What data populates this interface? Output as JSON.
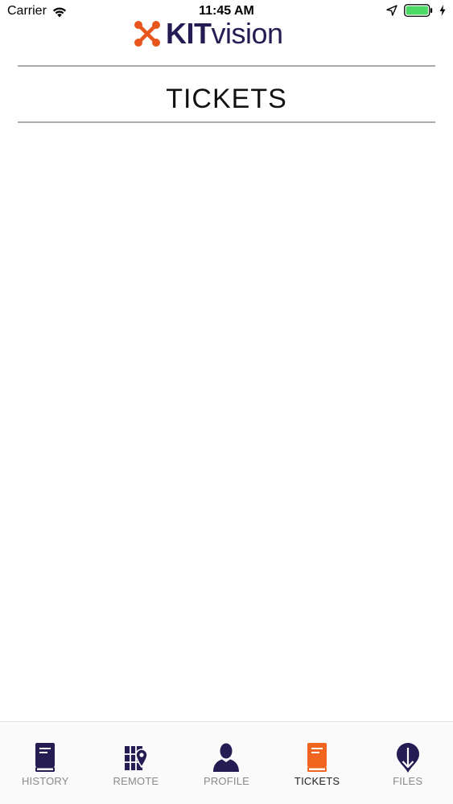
{
  "status_bar": {
    "carrier": "Carrier",
    "time": "11:45 AM"
  },
  "logo": {
    "kit": "KIT",
    "vision": "vision",
    "mark_color": "#e8561e",
    "text_color": "#241c52"
  },
  "header": {
    "title": "TICKETS"
  },
  "colors": {
    "tab_inactive_icon": "#241c52",
    "tab_active_icon": "#f0641e",
    "battery": "#4cd964"
  },
  "tabs": [
    {
      "label": "HISTORY",
      "icon": "book-icon",
      "active": false
    },
    {
      "label": "REMOTE",
      "icon": "map-pin-icon",
      "active": false
    },
    {
      "label": "PROFILE",
      "icon": "person-icon",
      "active": false
    },
    {
      "label": "TICKETS",
      "icon": "book-icon",
      "active": true
    },
    {
      "label": "FILES",
      "icon": "download-pin-icon",
      "active": false
    }
  ]
}
